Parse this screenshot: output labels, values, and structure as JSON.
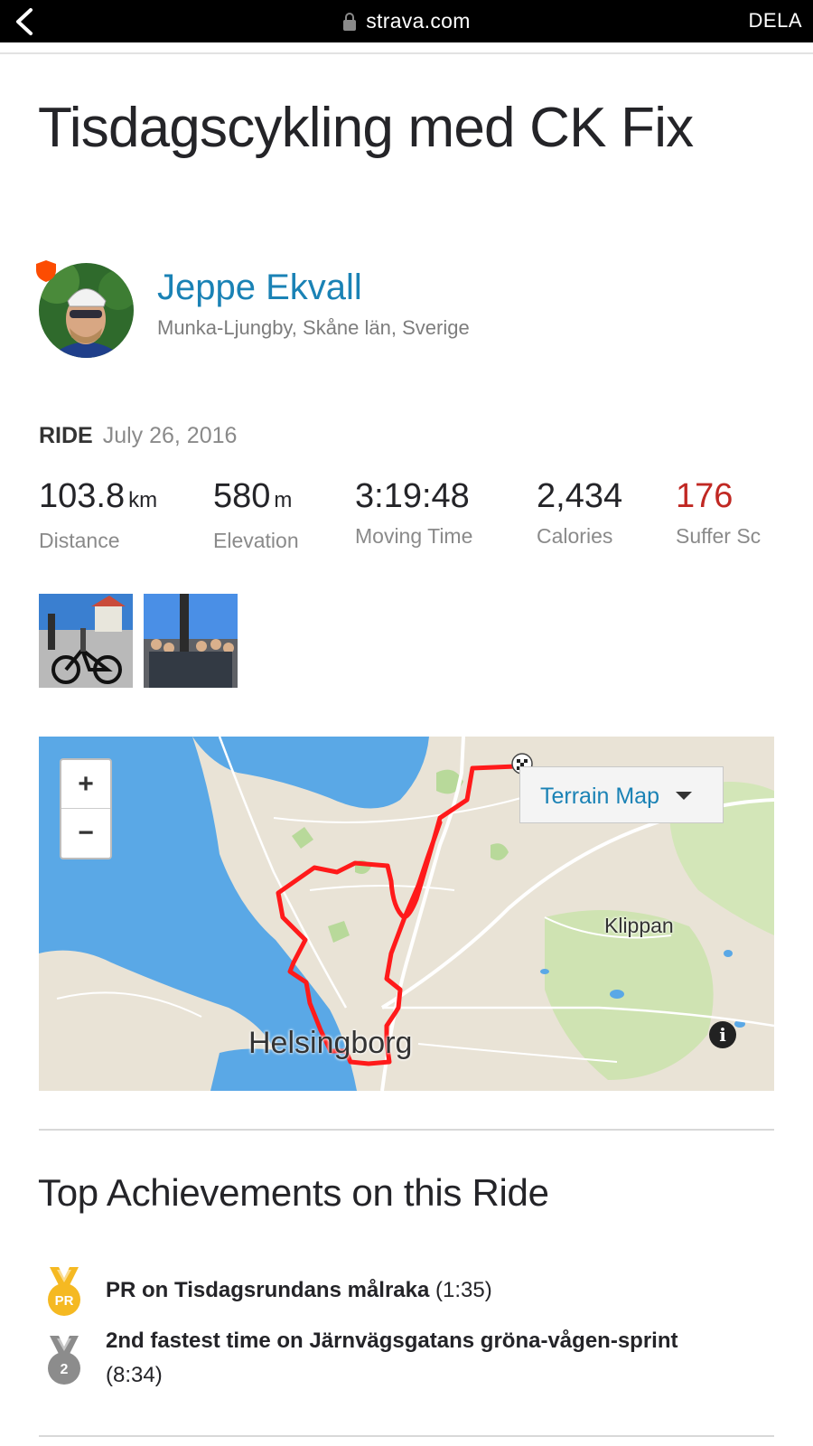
{
  "browser": {
    "url": "strava.com",
    "share_label": "DELA"
  },
  "activity": {
    "title": "Tisdagscykling med CK Fix",
    "athlete": {
      "name": "Jeppe Ekvall",
      "location": "Munka-Ljungby, Skåne län, Sverige"
    },
    "type_label": "RIDE",
    "date": "July 26, 2016",
    "stats": [
      {
        "value": "103.8",
        "unit": "km",
        "label": "Distance"
      },
      {
        "value": "580",
        "unit": "m",
        "label": "Elevation"
      },
      {
        "value": "3:19:48",
        "unit": "",
        "label": "Moving Time"
      },
      {
        "value": "2,434",
        "unit": "",
        "label": "Calories"
      },
      {
        "value": "176",
        "unit": "",
        "label": "Suffer Sc"
      }
    ]
  },
  "map": {
    "zoom_in": "+",
    "zoom_out": "−",
    "type_selector": "Terrain Map",
    "labels": {
      "klippan": "Klippan",
      "helsingborg": "Helsingborg"
    },
    "info": "i",
    "route_color": "#ff1a1a"
  },
  "achievements": {
    "heading": "Top Achievements on this Ride",
    "items": [
      {
        "badge": "PR",
        "text": "PR on Tisdagsrundans målraka",
        "time": "(1:35)"
      },
      {
        "badge": "2",
        "text": "2nd fastest time on Järnvägsgatans gröna-vågen-sprint",
        "time": "(8:34)"
      }
    ]
  },
  "colors": {
    "accent_link": "#1a82b5",
    "suffer": "#c02823",
    "gold": "#f5b922",
    "silver": "#8c8c8c"
  }
}
